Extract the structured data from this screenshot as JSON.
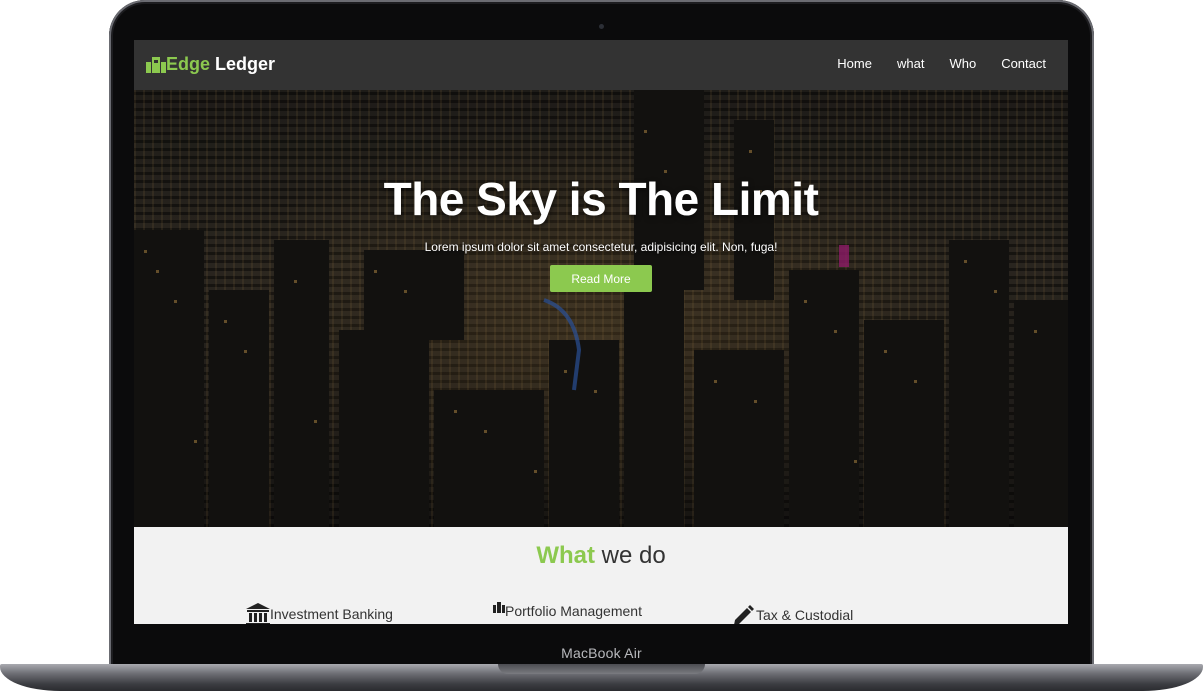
{
  "device": {
    "label": "MacBook Air"
  },
  "navbar": {
    "brand_accent": "Edge",
    "brand_rest": "Ledger",
    "brand_icon": "building-icon",
    "links": [
      {
        "label": "Home"
      },
      {
        "label": "what"
      },
      {
        "label": "Who"
      },
      {
        "label": "Contact"
      }
    ]
  },
  "hero": {
    "title": "The Sky is The Limit",
    "subtitle": "Lorem ipsum dolor sit amet consectetur, adipisicing elit. Non, fuga!",
    "button_label": "Read More"
  },
  "what_we_do": {
    "title_accent": "What",
    "title_rest": "we do",
    "services": [
      {
        "icon": "bank-icon",
        "label": "Investment Banking"
      },
      {
        "icon": "map-icon",
        "label": "Portfolio Management"
      },
      {
        "icon": "pencil-icon",
        "label": "Tax & Custodial"
      }
    ]
  },
  "colors": {
    "accent": "#8cc94f",
    "navbar_bg": "#333333",
    "section_bg": "#f2f2f2"
  }
}
